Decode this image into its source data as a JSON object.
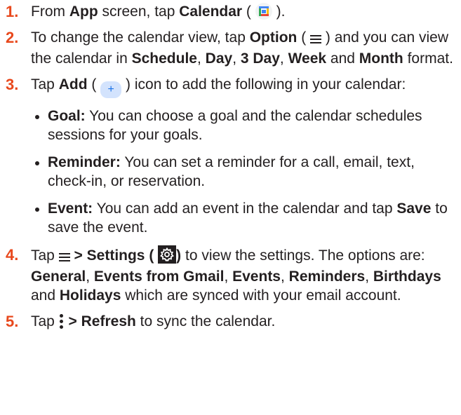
{
  "steps": [
    {
      "num": "1.",
      "t1": "From ",
      "app": "App",
      "t2": " screen, tap ",
      "calendar": "Calendar",
      "t3": " (",
      "t4": ")."
    },
    {
      "num": "2.",
      "t1": "To change the calendar view, tap ",
      "option": "Option",
      "t2": " (",
      "t3": ") and you can view the calendar in ",
      "schedule": "Schedule",
      "c1": ", ",
      "day": "Day",
      "c2": ", ",
      "day3": "3 Day",
      "c3": ", ",
      "week": "Week",
      "and": " and ",
      "month": "Month",
      "t4": " format."
    },
    {
      "num": "3.",
      "t1": "Tap ",
      "add": "Add",
      "t2": " (",
      "plus": "+",
      "t3": ") icon to add the following in your calendar:",
      "bullets": [
        {
          "term": "Goal:",
          "text": " You can choose a goal and the calendar schedules sessions for your goals."
        },
        {
          "term": "Reminder:",
          "text": " You can set a reminder for a call, email, text, check-in, or reservation."
        },
        {
          "term": "Event:",
          "text": " You can add an event in the calendar and tap ",
          "save": "Save",
          "text2": " to save the event."
        }
      ]
    },
    {
      "num": "4.",
      "t1": "Tap ",
      "settings": "> Settings (",
      "settings_close": ")",
      "t2": " to view the settings. The options are: ",
      "general": "General",
      "c1": ", ",
      "gmail": "Events from Gmail",
      "c2": ", ",
      "events": "Events",
      "c3": ", ",
      "reminders": "Reminders",
      "c4": ", ",
      "birthdays": "Birthdays",
      "and": " and ",
      "holidays": "Holidays",
      "t3": " which are synced with your email account."
    },
    {
      "num": "5.",
      "t1": "Tap ",
      "refresh": "> Refresh",
      "t2": " to sync the calendar."
    }
  ],
  "icons": {
    "calendar": "calendar-app-icon",
    "menu": "hamburger-menu-icon",
    "add": "plus-icon",
    "settings": "gear-icon",
    "more": "more-vertical-icon"
  },
  "colors": {
    "step_number": "#e8481c",
    "text": "#231f20",
    "add_bg": "#d3e3fd"
  }
}
